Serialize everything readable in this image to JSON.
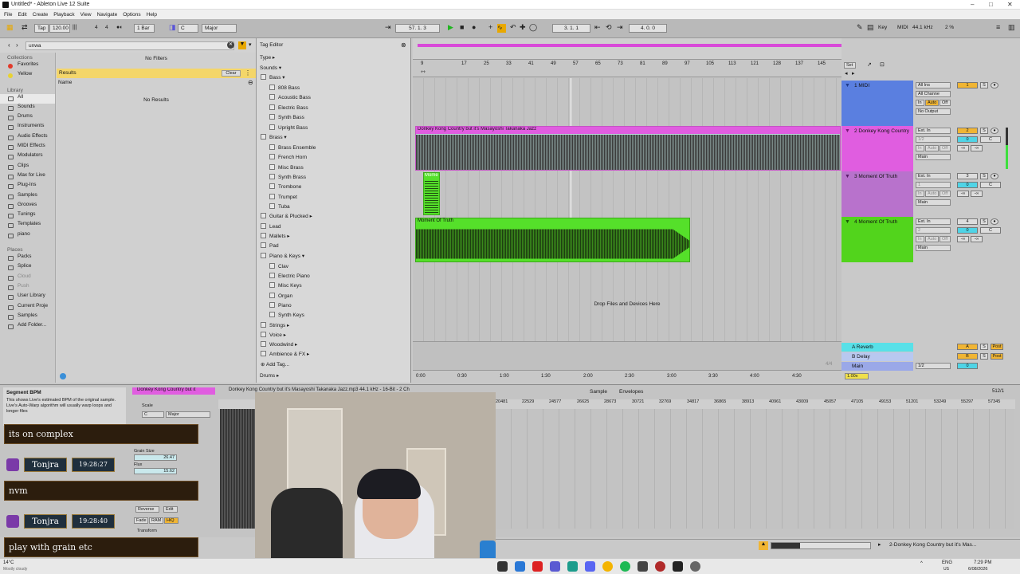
{
  "titlebar": {
    "title": "Untitled* - Ableton Live 12 Suite"
  },
  "menu": [
    "File",
    "Edit",
    "Create",
    "Playback",
    "View",
    "Navigate",
    "Options",
    "Help"
  ],
  "control": {
    "tap": "Tap",
    "tempo": "120.00",
    "meter_num": "4",
    "meter_den": "4",
    "quant": "1 Bar",
    "key": "C",
    "scale": "Major",
    "position": "57.   1.   3",
    "loop_start": "3.   1.   1",
    "loop_len": "4.   0.   0",
    "key_label": "Key",
    "midi_label": "MIDI",
    "sample_rate": "44.1 kHz",
    "cpu": "2 %"
  },
  "browser": {
    "search": "unwa",
    "no_filters": "No Filters",
    "results": "Results",
    "clear": "Clear",
    "name_col": "Name",
    "no_results": "No Results",
    "collections_header": "Collections",
    "collections": [
      {
        "label": "Favorites",
        "color": "#e23a2a"
      },
      {
        "label": "Yellow",
        "color": "#e8d232"
      }
    ],
    "library_header": "Library",
    "library": [
      "All",
      "Sounds",
      "Drums",
      "Instruments",
      "Audio Effects",
      "MIDI Effects",
      "Modulators",
      "Clips",
      "Max for Live",
      "Plug-Ins",
      "Samples",
      "Grooves",
      "Tunings",
      "Templates",
      "piano"
    ],
    "places_header": "Places",
    "places": [
      "Packs",
      "Splice",
      "Cloud",
      "Push",
      "User Library",
      "Current Proje",
      "Samples",
      "Add Folder..."
    ]
  },
  "tag_editor": {
    "title": "Tag Editor",
    "type": "Type",
    "sounds": "Sounds",
    "bass": "Bass",
    "bass_items": [
      "808 Bass",
      "Acoustic Bass",
      "Electric Bass",
      "Synth Bass",
      "Upright Bass"
    ],
    "brass": "Brass",
    "brass_items": [
      "Brass Ensemble",
      "French Horn",
      "Misc Brass",
      "Synth Brass",
      "Trombone",
      "Trumpet",
      "Tuba"
    ],
    "guitar": "Guitar & Plucked",
    "lead": "Lead",
    "mallets": "Mallets",
    "pad": "Pad",
    "piano": "Piano & Keys",
    "piano_items": [
      "Clav",
      "Electric Piano",
      "Misc Keys",
      "Organ",
      "Piano",
      "Synth Keys"
    ],
    "strings": "Strings",
    "voice": "Voice",
    "woodwind": "Woodwind",
    "ambience": "Ambience & FX",
    "add_tag": "Add Tag...",
    "drums": "Drums"
  },
  "arrangement": {
    "bars": [
      "9",
      "17",
      "25",
      "33",
      "41",
      "49",
      "57",
      "65",
      "73",
      "81",
      "89",
      "97",
      "105",
      "113",
      "121",
      "128",
      "137",
      "145"
    ],
    "times": [
      "0:00",
      "0:30",
      "1:00",
      "1:30",
      "2:00",
      "2:30",
      "3:00",
      "3:30",
      "4:00",
      "4:30"
    ],
    "clip_dk": "Donkey Kong Country but it's Masayoshi Takanaka Jazz",
    "clip_mome": "Mome",
    "clip_mot": "Moment Of Truth",
    "drop": "Drop Files and Devices Here",
    "set": "Set",
    "time_sig": "4/4"
  },
  "tracks": [
    {
      "num": "1",
      "name": "1 MIDI",
      "color": "#5a7fe0",
      "in": "All Ins",
      "ch": "All Channe",
      "out": "No Output",
      "auto": "Auto",
      "in_btn": "In",
      "off": "Off"
    },
    {
      "num": "2",
      "name": "2 Donkey Kong Country",
      "color": "#e05de0",
      "in": "Ext. In",
      "ch": "1/2",
      "out": "Main",
      "auto": "Auto",
      "in_btn": "In",
      "off": "Off"
    },
    {
      "num": "3",
      "name": "3 Moment Of Truth",
      "color": "#b872cc",
      "in": "Ext. In",
      "ch": "1",
      "out": "Main",
      "auto": "Auto",
      "in_btn": "In",
      "off": "Off"
    },
    {
      "num": "4",
      "name": "4 Moment Of Truth",
      "color": "#52d41c",
      "in": "Ext. In",
      "ch": "2",
      "out": "Main",
      "auto": "Auto",
      "in_btn": "In",
      "off": "Off"
    }
  ],
  "returns": [
    {
      "name": "A Reverb",
      "letter": "A",
      "post": "Post"
    },
    {
      "name": "B Delay",
      "letter": "B",
      "post": "Post"
    },
    {
      "name": "Main",
      "letter": "1/2",
      "post": "0"
    }
  ],
  "mixer": {
    "s": "S",
    "c": "C",
    "inf": "-∞",
    "zero": "0",
    "zoom": "1.00x"
  },
  "bottom": {
    "segment_title": "Segment BPM",
    "segment_text": "This shows Live's estimated BPM of the original sample. Live's Auto-Warp algorithm will usually warp loops and longer files",
    "clip_title": "Donkey Kong Country but it",
    "sample_info": "Donkey Kong Country but it's Masayoshi Takanaka Jazz.mp3   44.1 kHz - 16-Bit - 2 Ch",
    "sample_tab": "Sample",
    "env_tab": "Envelopes",
    "page": "512/1",
    "scale": "Scale",
    "key": "C",
    "mode": "Major",
    "grain_label": "Grain Size",
    "grain": "26.47",
    "flux_label": "Flux",
    "flux": "15.62",
    "reverse": "Reverse",
    "edit": "Edit",
    "fade": "Fade",
    "ram": "RAM",
    "hiq": "HiQ",
    "transform": "Transform",
    "ruler": [
      "20481",
      "22529",
      "24577",
      "26625",
      "28673",
      "30721",
      "32769",
      "34817",
      "36865",
      "38913",
      "40961",
      "43009",
      "45057",
      "47105",
      "49153",
      "51201",
      "53249",
      "55297",
      "57345"
    ]
  },
  "chat": [
    {
      "type": "msg",
      "text": "its on complex"
    },
    {
      "type": "user",
      "name": "Tonjra",
      "time": "19:28:27"
    },
    {
      "type": "msg",
      "text": "nvm"
    },
    {
      "type": "user",
      "name": "Tonjra",
      "time": "19:28:40"
    },
    {
      "type": "msg",
      "text": "play with grain etc"
    }
  ],
  "status": {
    "track_name": "2-Donkey Kong Country but it's Mas..."
  },
  "taskbar": {
    "weather_temp": "14°C",
    "weather_desc": "Mostly cloudy",
    "lang": "ENG",
    "region": "US",
    "time": "7:29 PM",
    "date": "6/08/2026"
  }
}
